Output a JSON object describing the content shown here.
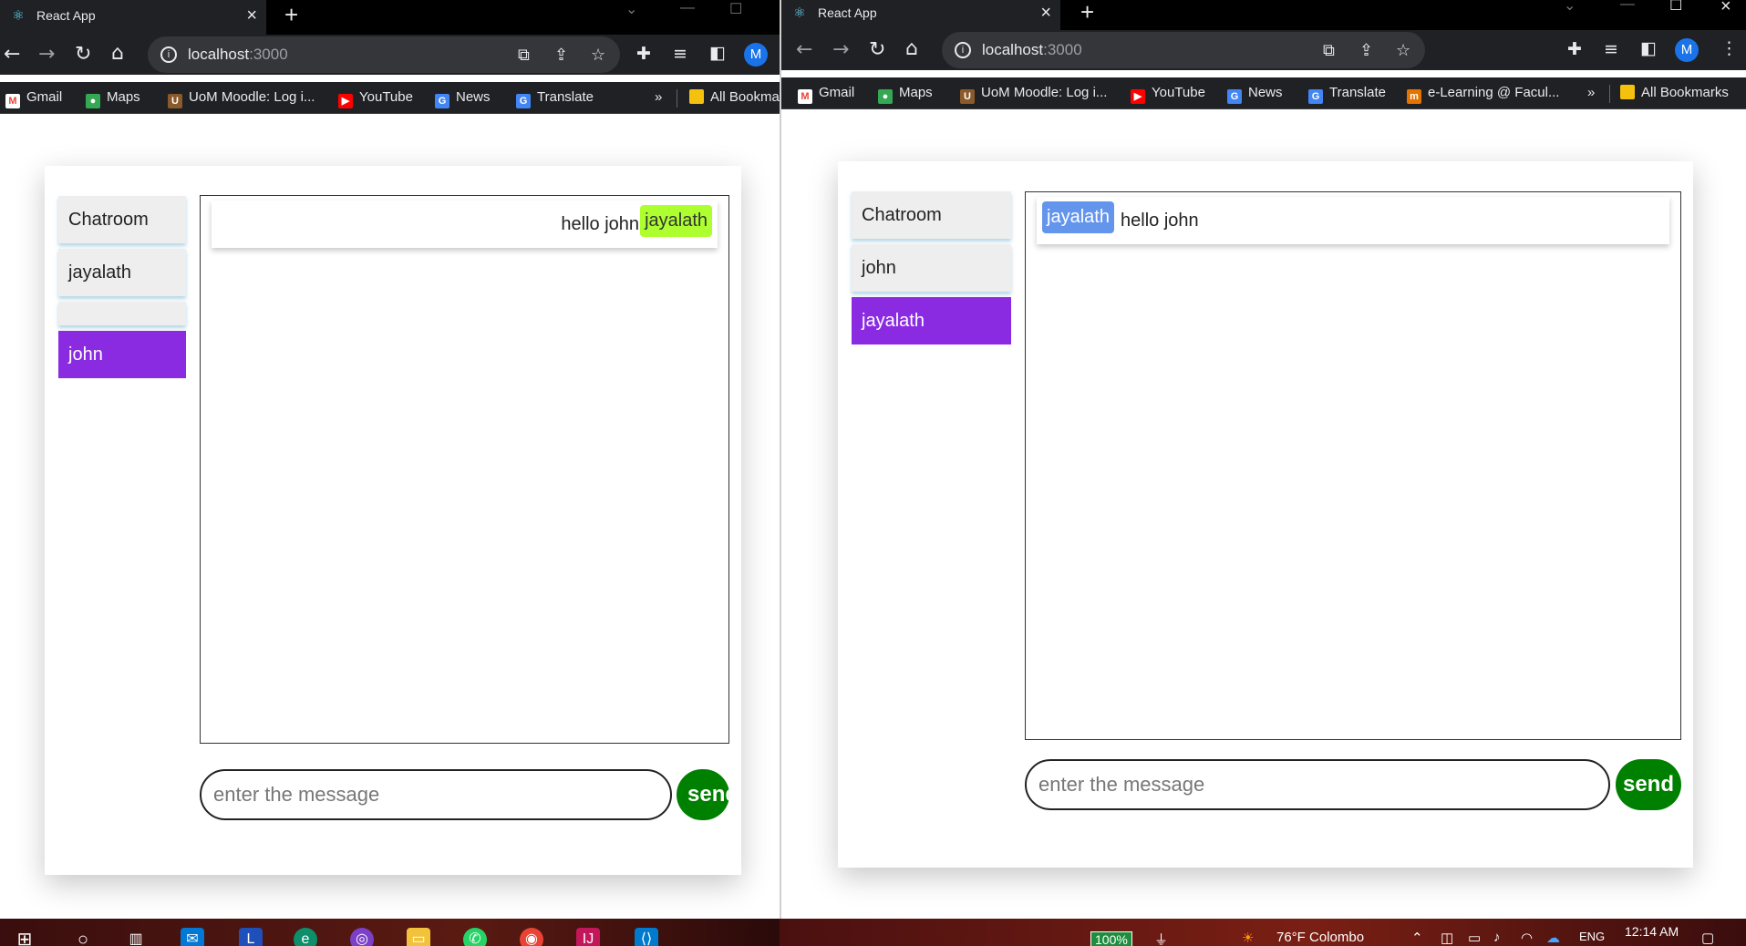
{
  "left_window": {
    "tab_title": "React App",
    "url_host": "localhost",
    "url_port": ":3000",
    "avatar_letter": "M",
    "bookmarks": [
      "Gmail",
      "Maps",
      "UoM Moodle: Log i...",
      "YouTube",
      "News",
      "Translate"
    ],
    "bookmarks_overflow": "»",
    "all_bookmarks": "All Bookma",
    "users": [
      "Chatroom",
      "jayalath",
      "",
      "john"
    ],
    "active_user": "john",
    "message": {
      "sender": "jayalath",
      "text": "hello john"
    },
    "input_placeholder": "enter the message",
    "send_label": "send"
  },
  "right_window": {
    "tab_title": "React App",
    "url_host": "localhost",
    "url_port": ":3000",
    "avatar_letter": "M",
    "bookmarks": [
      "Gmail",
      "Maps",
      "UoM Moodle: Log i...",
      "YouTube",
      "News",
      "Translate",
      "e-Learning @ Facul..."
    ],
    "bookmarks_overflow": "»",
    "all_bookmarks": "All Bookmarks",
    "users": [
      "Chatroom",
      "john",
      "jayalath"
    ],
    "active_user": "jayalath",
    "message": {
      "sender": "jayalath",
      "text": "hello john"
    },
    "input_placeholder": "enter the message",
    "send_label": "send"
  },
  "taskbar": {
    "battery": "100%",
    "weather": "76°F Colombo",
    "language": "ENG",
    "time": "12:14 AM"
  },
  "colors": {
    "active_user_bg": "#8a2be2",
    "own_sender_badge": "#adff2f",
    "other_sender_badge": "#6495ed",
    "send_button": "#008000"
  }
}
